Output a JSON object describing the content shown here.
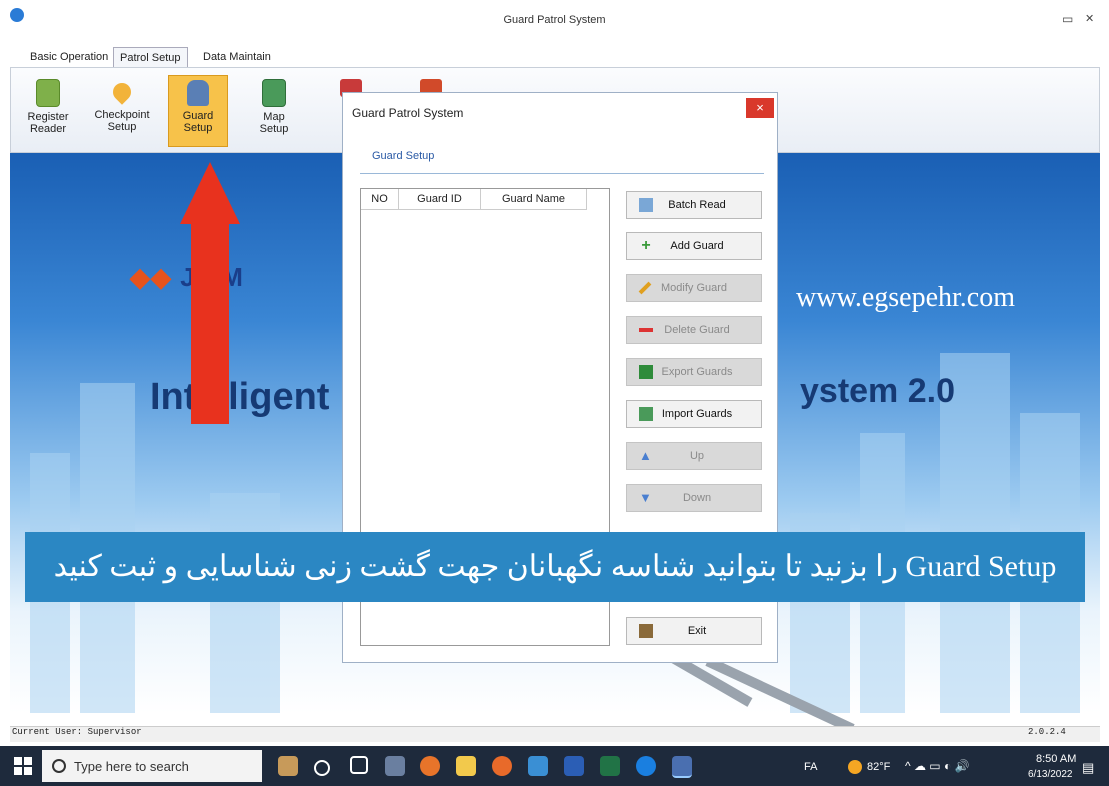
{
  "window": {
    "title": "Guard Patrol System",
    "min_glyph": "▭",
    "close_glyph": "✕"
  },
  "tabs": [
    {
      "label": "Basic Operation"
    },
    {
      "label": "Patrol Setup",
      "active": true
    },
    {
      "label": "Data Maintain"
    }
  ],
  "ribbon": {
    "register": {
      "line1": "Register",
      "line2": "Reader"
    },
    "checkpoint": {
      "line1": "Checkpoint",
      "line2": "Setup"
    },
    "guard": {
      "line1": "Guard",
      "line2": "Setup",
      "selected": true
    },
    "map": {
      "line1": "Map",
      "line2": "Setup"
    }
  },
  "background": {
    "logo": "JWM",
    "website": "www.egsepehr.com",
    "title_left": "Intelligent",
    "title_right": "ystem 2.0"
  },
  "dialog": {
    "title": "Guard Patrol System",
    "close_glyph": "×",
    "heading": "Guard Setup",
    "table": {
      "columns": [
        "NO",
        "Guard ID",
        "Guard Name"
      ],
      "rows": []
    },
    "buttons": [
      {
        "label": "Batch Read",
        "enabled": true,
        "icon": "batch-read-icon",
        "color": "#7aa7d6"
      },
      {
        "label": "Add Guard",
        "enabled": true,
        "icon": "plus-icon",
        "color": "#3a9a3a"
      },
      {
        "label": "Modify Guard",
        "enabled": false,
        "icon": "pencil-icon",
        "color": "#e0a020"
      },
      {
        "label": "Delete Guard",
        "enabled": false,
        "icon": "minus-icon",
        "color": "#d33"
      },
      {
        "label": "Export Guards",
        "enabled": false,
        "icon": "excel-icon",
        "color": "#2e8b3a"
      },
      {
        "label": "Import Guards",
        "enabled": true,
        "icon": "import-icon",
        "color": "#4a9a5a"
      },
      {
        "label": "Up",
        "enabled": false,
        "icon": "arrow-up-icon",
        "color": "#4a7fd0"
      },
      {
        "label": "Down",
        "enabled": false,
        "icon": "arrow-down-icon",
        "color": "#4a7fd0"
      },
      {
        "label": "Exit",
        "enabled": true,
        "icon": "exit-door-icon",
        "color": "#8a6a3a"
      }
    ]
  },
  "banner": {
    "text": "Guard Setup را بزنید تا بتوانید شناسه نگهبانان جهت گشت زنی شناسایی و ثبت کنید"
  },
  "status": {
    "user_label": "Current User:",
    "user": "Supervisor",
    "version": "2.0.2.4"
  },
  "taskbar": {
    "search_placeholder": "Type here to search",
    "lang": "FA",
    "temp": "82°F",
    "time": "8:50 AM",
    "date": "6/13/2022",
    "tray_glyphs": "^ ☁ ▭ ◐ 🔊"
  },
  "colors": {
    "accent": "#2b87c3",
    "arrow": "#e8321e",
    "selected_tab": "#f7c24a"
  }
}
